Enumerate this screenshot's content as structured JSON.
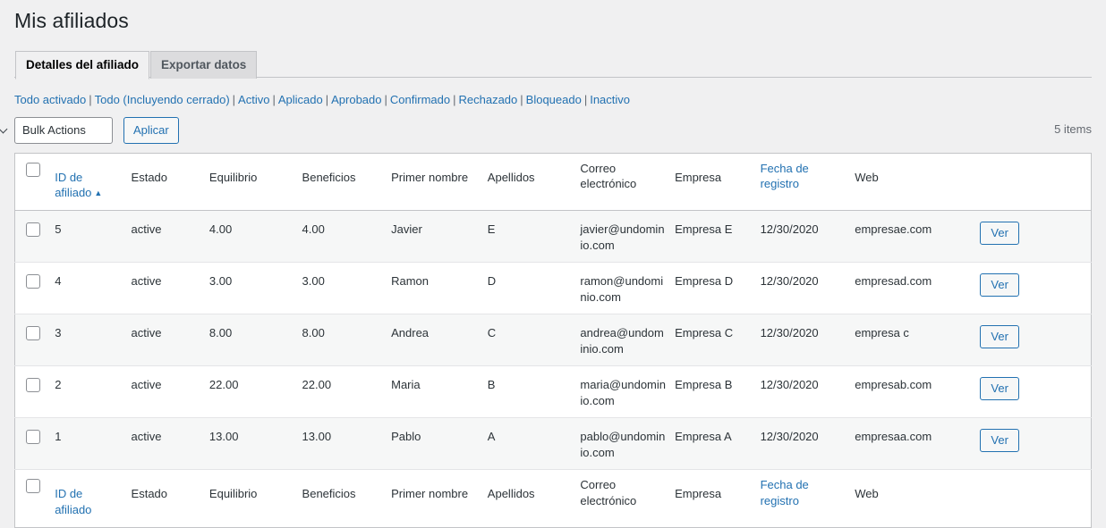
{
  "page": {
    "title": "Mis afiliados"
  },
  "tabs": [
    {
      "label": "Detalles del afiliado",
      "active": true
    },
    {
      "label": "Exportar datos",
      "active": false
    }
  ],
  "filters": [
    "Todo activado",
    "Todo (Incluyendo cerrado)",
    "Activo",
    "Aplicado",
    "Aprobado",
    "Confirmado",
    "Rechazado",
    "Bloqueado",
    "Inactivo"
  ],
  "filter_separator": "|",
  "tablenav": {
    "bulk_actions_label": "Bulk Actions",
    "bulk_actions_options": [
      "Bulk Actions"
    ],
    "apply_label": "Aplicar",
    "displaying_num": "5 items",
    "dropdown_icon": "chevron-down-icon"
  },
  "table": {
    "columns": [
      {
        "key": "id",
        "label": "ID de afiliado",
        "link": true,
        "sorted": true,
        "sort_arrow": "▲"
      },
      {
        "key": "status",
        "label": "Estado",
        "link": false
      },
      {
        "key": "balance",
        "label": "Equilibrio",
        "link": false
      },
      {
        "key": "earnings",
        "label": "Beneficios",
        "link": false
      },
      {
        "key": "first_name",
        "label": "Primer nombre",
        "link": false
      },
      {
        "key": "last_name",
        "label": "Apellidos",
        "link": false
      },
      {
        "key": "email",
        "label": "Correo electrónico",
        "link": false
      },
      {
        "key": "company",
        "label": "Empresa",
        "link": false
      },
      {
        "key": "date",
        "label": "Fecha de registro",
        "link": true
      },
      {
        "key": "web",
        "label": "Web",
        "link": false
      }
    ],
    "footer_columns": [
      {
        "key": "id",
        "label": "ID de afiliado",
        "link": true
      },
      {
        "key": "status",
        "label": "Estado",
        "link": false
      },
      {
        "key": "balance",
        "label": "Equilibrio",
        "link": false
      },
      {
        "key": "earnings",
        "label": "Beneficios",
        "link": false
      },
      {
        "key": "first_name",
        "label": "Primer nombre",
        "link": false
      },
      {
        "key": "last_name",
        "label": "Apellidos",
        "link": false
      },
      {
        "key": "email",
        "label": "Correo electrónico",
        "link": false
      },
      {
        "key": "company",
        "label": "Empresa",
        "link": false
      },
      {
        "key": "date",
        "label": "Fecha de registro",
        "link": true
      },
      {
        "key": "web",
        "label": "Web",
        "link": false
      }
    ],
    "action_label": "Ver",
    "rows": [
      {
        "id": "5",
        "status": "active",
        "balance": "4.00",
        "earnings": "4.00",
        "first_name": "Javier",
        "last_name": "E",
        "email": "javier@undominio.com",
        "company": "Empresa E",
        "date": "12/30/2020",
        "web": "empresae.com",
        "action": "Ver"
      },
      {
        "id": "4",
        "status": "active",
        "balance": "3.00",
        "earnings": "3.00",
        "first_name": "Ramon",
        "last_name": "D",
        "email": "ramon@undominio.com",
        "company": "Empresa D",
        "date": "12/30/2020",
        "web": "empresad.com",
        "action": "Ver"
      },
      {
        "id": "3",
        "status": "active",
        "balance": "8.00",
        "earnings": "8.00",
        "first_name": "Andrea",
        "last_name": "C",
        "email": "andrea@undominio.com",
        "company": "Empresa C",
        "date": "12/30/2020",
        "web": "empresa c",
        "action": "Ver"
      },
      {
        "id": "2",
        "status": "active",
        "balance": "22.00",
        "earnings": "22.00",
        "first_name": "Maria",
        "last_name": "B",
        "email": "maria@undominio.com",
        "company": "Empresa B",
        "date": "12/30/2020",
        "web": "empresab.com",
        "action": "Ver"
      },
      {
        "id": "1",
        "status": "active",
        "balance": "13.00",
        "earnings": "13.00",
        "first_name": "Pablo",
        "last_name": "A",
        "email": "pablo@undominio.com",
        "company": "Empresa A",
        "date": "12/30/2020",
        "web": "empresaa.com",
        "action": "Ver"
      }
    ]
  },
  "colors": {
    "link": "#2271b1",
    "page_bg": "#f0f0f1",
    "table_border": "#c3c4c7",
    "alt_row": "#f6f7f7"
  }
}
